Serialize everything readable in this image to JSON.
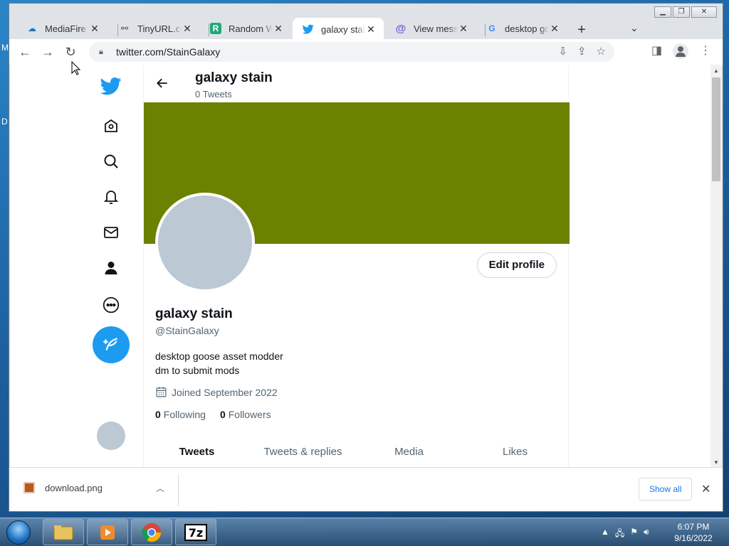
{
  "desktop": {
    "edge_letters": [
      "M",
      "D"
    ]
  },
  "browser": {
    "tabs": [
      {
        "title": "MediaFire -",
        "icon": "mediafire-icon",
        "active": false
      },
      {
        "title": "TinyURL.com",
        "icon": "tinyurl-icon",
        "active": false
      },
      {
        "title": "Random Wo",
        "icon": "random-words-icon",
        "active": false
      },
      {
        "title": "galaxy stain",
        "icon": "twitter-icon",
        "active": true
      },
      {
        "title": "View messa",
        "icon": "at-sign-icon",
        "active": false
      },
      {
        "title": "desktop goo",
        "icon": "google-icon",
        "active": false
      }
    ],
    "tab_favicon_glyphs": [
      "☁",
      "⚯",
      "R",
      "",
      "@",
      "G"
    ],
    "url": "twitter.com/StainGalaxy"
  },
  "twitter": {
    "accent": "#1d9bf0",
    "banner_color": "#6b8100",
    "header": {
      "name": "galaxy stain",
      "tweet_count": "0 Tweets"
    },
    "profile": {
      "edit_button": "Edit profile",
      "name": "galaxy stain",
      "handle": "@StainGalaxy",
      "bio_line1": "desktop goose asset modder",
      "bio_line2": "dm to submit mods",
      "joined": "Joined September 2022",
      "following_count": "0",
      "following_label": "Following",
      "followers_count": "0",
      "followers_label": "Followers"
    },
    "tabs": [
      "Tweets",
      "Tweets & replies",
      "Media",
      "Likes"
    ],
    "active_tab": "Tweets"
  },
  "download_shelf": {
    "filename": "download.png",
    "show_all": "Show all"
  },
  "taskbar": {
    "time": "6:07 PM",
    "date": "9/16/2022"
  }
}
